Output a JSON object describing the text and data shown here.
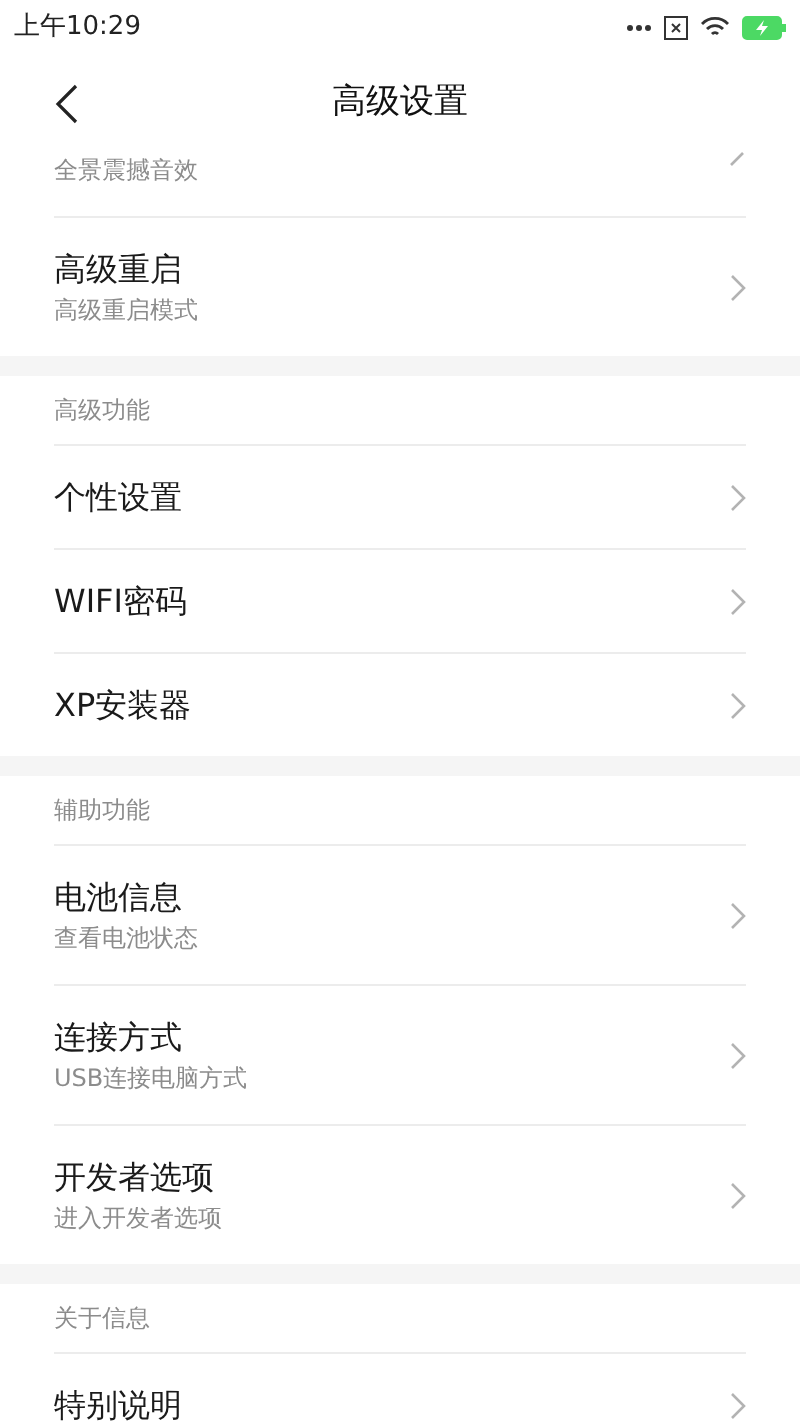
{
  "status_bar": {
    "time": "上午10:29"
  },
  "header": {
    "title": "高级设置"
  },
  "sections": [
    {
      "items": [
        {
          "subtitle": "全景震撼音效"
        },
        {
          "title": "高级重启",
          "subtitle": "高级重启模式"
        }
      ]
    },
    {
      "heading": "高级功能",
      "items": [
        {
          "title": "个性设置"
        },
        {
          "title": "WIFI密码"
        },
        {
          "title": "XP安装器"
        }
      ]
    },
    {
      "heading": "辅助功能",
      "items": [
        {
          "title": "电池信息",
          "subtitle": "查看电池状态"
        },
        {
          "title": "连接方式",
          "subtitle": "USB连接电脑方式"
        },
        {
          "title": "开发者选项",
          "subtitle": "进入开发者选项"
        }
      ]
    },
    {
      "heading": "关于信息",
      "items": [
        {
          "title": "特别说明"
        }
      ]
    }
  ]
}
